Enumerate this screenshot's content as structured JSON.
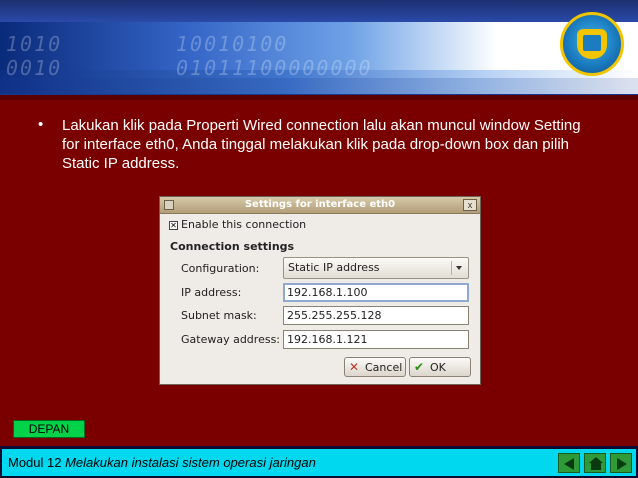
{
  "slide": {
    "bullet_marker": "•",
    "bullet_text": "Lakukan klik pada Properti Wired connection lalu akan muncul window Setting for interface eth0, Anda tinggal melakukan klik pada drop-down box dan pilih Static IP address."
  },
  "banner": {
    "binary_1": "1010",
    "binary_2": "0010",
    "binary_3": "10010100",
    "binary_4": "01011100000000"
  },
  "dialog": {
    "title": "Settings for interface eth0",
    "close_glyph": "x",
    "enable_checkbox": {
      "label": "Enable this connection",
      "checked_glyph": "✕"
    },
    "section_title": "Connection settings",
    "configuration": {
      "label": "Configuration:",
      "value": "Static IP address"
    },
    "ip_address": {
      "label": "IP address:",
      "value": "192.168.1.100"
    },
    "subnet_mask": {
      "label": "Subnet mask:",
      "value": "255.255.255.128"
    },
    "gateway_address": {
      "label": "Gateway address:",
      "value": "192.168.1.121"
    },
    "cancel_button": {
      "icon": "✕",
      "label": "Cancel"
    },
    "ok_button": {
      "icon": "✔",
      "label": "OK"
    }
  },
  "bottom": {
    "depan_label": "DEPAN",
    "footer_prefix": "Modul 12 ",
    "footer_italic": "Melakukan instalasi sistem operasi jaringan"
  },
  "colors": {
    "slide_background": "#7a0000",
    "depan_button": "#00d24a",
    "footer_bar": "#00d8f0",
    "nav_buttons": "#2e9a3a"
  },
  "icons": [
    "school-logo-icon",
    "window-menu-icon",
    "close-icon",
    "dropdown-arrow-icon",
    "cancel-icon",
    "ok-check-icon",
    "prev-arrow-icon",
    "home-icon",
    "next-arrow-icon"
  ]
}
